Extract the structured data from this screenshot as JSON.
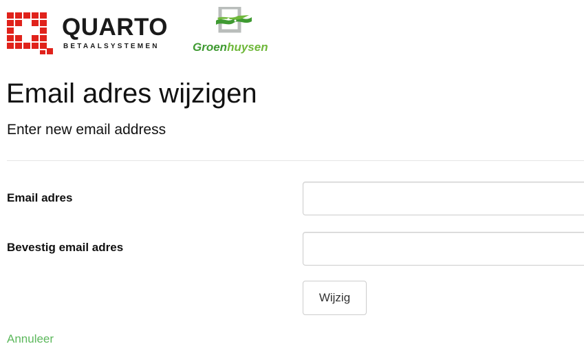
{
  "header": {
    "quarto_logo": {
      "word": "QUARTO",
      "sub": "BETAALSYSTEMEN",
      "mark_color": "#e0221b",
      "text_color": "#1a1a1a"
    },
    "groenhuysen_logo": {
      "word_part1": "Groen",
      "word_part2": "huysen",
      "color_dark": "#3f9a32",
      "color_light": "#6fb83a"
    }
  },
  "page": {
    "title": "Email adres wijzigen",
    "subtitle": "Enter new email address"
  },
  "form": {
    "email_label": "Email adres",
    "email_value": "",
    "confirm_label": "Bevestig email adres",
    "confirm_value": "",
    "submit_label": "Wijzig"
  },
  "footer": {
    "cancel_label": "Annuleer",
    "cancel_color": "#5cb85c"
  }
}
